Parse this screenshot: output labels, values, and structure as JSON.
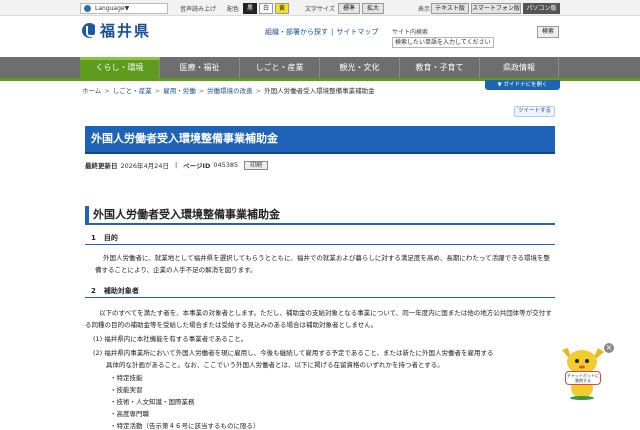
{
  "utility": {
    "language": "Language▼",
    "speech": "音声読み上げ",
    "color_label": "配色",
    "color_options": [
      "黒",
      "白",
      "黄"
    ],
    "font_size_label": "文字サイズ",
    "font_standard": "標準",
    "font_large": "拡大",
    "display_label": "表示",
    "display_text": "テキスト版",
    "display_smartphone": "スマートフォン版",
    "display_pc": "パソコン版"
  },
  "header": {
    "logo_text": "福井県",
    "links": [
      "組織・部署から探す",
      "サイトマップ"
    ],
    "site_search_label": "サイト内検索",
    "site_search_placeholder": "検索したい単語を入力してください",
    "search_button": "検索"
  },
  "nav": {
    "items": [
      "くらし・環境",
      "医療・福祉",
      "しごと・産業",
      "観光・文化",
      "教育・子育て",
      "県政情報"
    ]
  },
  "breadcrumb": [
    "ホーム",
    "しごと・産業",
    "雇用・労働",
    "労働環境の改善",
    "外国人労働者受入環境整備事業補助金"
  ],
  "guide_button": "▼ ガイドナビを開く",
  "tweet_button": "ツイートする",
  "page": {
    "title": "外国人労働者受入環境整備事業補助金",
    "updated_label": "最終更新日",
    "updated_value": "2026年4月24日",
    "page_id_label": "ページID",
    "page_id_value": "045385",
    "print_button": "印刷"
  },
  "content": {
    "heading": "外国人労働者受入環境整備事業補助金",
    "s1_num": "1",
    "s1_title": "目的",
    "s1_text": "外国人労働者に、就業地として福井県を選択してもらうとともに、福井での就業および暮らしに対する満足度を高め、長期にわたって活躍できる環境を整備することにより、企業の人手不足の解消を図ります。",
    "s2_num": "2",
    "s2_title": "補助対象者",
    "s2_text": "以下のすべてを満たす者を、本事業の対象者とします。ただし、補助金の支給対象となる事業について、同一年度内に国または他の地方公共団体等が交付する同種の目的の補助金等を受給した場合または受給する見込みのある場合は補助対象者としません。",
    "s2_item1": "(1) 福井県内に本社機能を有する事業者であること。",
    "s2_item2_line1": "(2) 福井県内事業所において外国人労働者を現に雇用し、今後も継続して雇用する予定であること、または新たに外国人労働者を雇用する",
    "s2_item2_line2": "具体的な計画があること。なお、ここでいう外国人労働者とは、以下に掲げる在留資格のいずれかを持つ者とする。",
    "visa_list": [
      "・特定技能",
      "・技能実習",
      "・技術・人文知識・国際業務",
      "・高度専門職",
      "・特定活動（告示第４６号に該当するものに限る）"
    ]
  },
  "chatbot": {
    "label": "チャットボットに質問する"
  }
}
